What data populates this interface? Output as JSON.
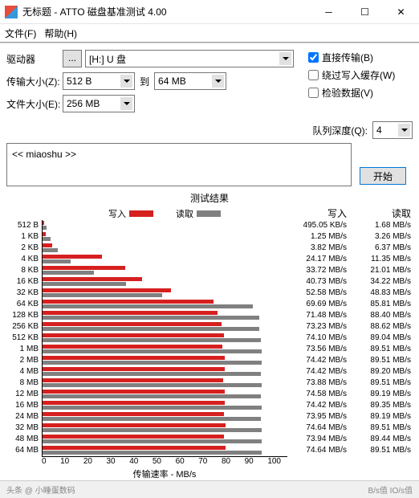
{
  "window": {
    "title": "无标题 - ATTO 磁盘基准测试 4.00"
  },
  "menu": {
    "file": "文件(F)",
    "help": "帮助(H)"
  },
  "labels": {
    "drive": "驱动器",
    "transfer_size": "传输大小(Z):",
    "to": "到",
    "file_size": "文件大小(E):",
    "queue_depth": "队列深度(Q):"
  },
  "controls": {
    "drive_dots": "...",
    "drive_value": "[H:] U 盘",
    "size_from": "512 B",
    "size_to": "64 MB",
    "file_size": "256 MB",
    "queue_depth": "4",
    "start": "开始"
  },
  "checkboxes": {
    "direct_io": "直接传输(B)",
    "bypass_cache": "绕过写入缓存(W)",
    "verify": "检验数据(V)"
  },
  "desc": {
    "text": "<< miaoshu >>"
  },
  "results": {
    "title": "测试结果",
    "write_legend": "写入",
    "read_legend": "读取",
    "write_hdr": "写入",
    "read_hdr": "读取",
    "x_label": "传输速率 - MB/s"
  },
  "chart_data": {
    "type": "bar",
    "x_ticks": [
      0,
      10,
      20,
      30,
      40,
      50,
      60,
      70,
      80,
      90,
      100
    ],
    "xlabel": "传输速率 - MB/s",
    "ylabel": "",
    "xlim": [
      0,
      100
    ],
    "series": [
      {
        "name": "写入",
        "color": "#d62020"
      },
      {
        "name": "读取",
        "color": "#808080"
      }
    ],
    "rows": [
      {
        "size": "512 B",
        "write": 0.495,
        "read": 1.68,
        "write_txt": "495.05 KB/s",
        "read_txt": "1.68 MB/s"
      },
      {
        "size": "1 KB",
        "write": 1.25,
        "read": 3.26,
        "write_txt": "1.25 MB/s",
        "read_txt": "3.26 MB/s"
      },
      {
        "size": "2 KB",
        "write": 3.82,
        "read": 6.37,
        "write_txt": "3.82 MB/s",
        "read_txt": "6.37 MB/s"
      },
      {
        "size": "4 KB",
        "write": 24.17,
        "read": 11.35,
        "write_txt": "24.17 MB/s",
        "read_txt": "11.35 MB/s"
      },
      {
        "size": "8 KB",
        "write": 33.72,
        "read": 21.01,
        "write_txt": "33.72 MB/s",
        "read_txt": "21.01 MB/s"
      },
      {
        "size": "16 KB",
        "write": 40.73,
        "read": 34.22,
        "write_txt": "40.73 MB/s",
        "read_txt": "34.22 MB/s"
      },
      {
        "size": "32 KB",
        "write": 52.58,
        "read": 48.83,
        "write_txt": "52.58 MB/s",
        "read_txt": "48.83 MB/s"
      },
      {
        "size": "64 KB",
        "write": 69.69,
        "read": 85.81,
        "write_txt": "69.69 MB/s",
        "read_txt": "85.81 MB/s"
      },
      {
        "size": "128 KB",
        "write": 71.48,
        "read": 88.4,
        "write_txt": "71.48 MB/s",
        "read_txt": "88.40 MB/s"
      },
      {
        "size": "256 KB",
        "write": 73.23,
        "read": 88.62,
        "write_txt": "73.23 MB/s",
        "read_txt": "88.62 MB/s"
      },
      {
        "size": "512 KB",
        "write": 74.1,
        "read": 89.04,
        "write_txt": "74.10 MB/s",
        "read_txt": "89.04 MB/s"
      },
      {
        "size": "1 MB",
        "write": 73.56,
        "read": 89.51,
        "write_txt": "73.56 MB/s",
        "read_txt": "89.51 MB/s"
      },
      {
        "size": "2 MB",
        "write": 74.42,
        "read": 89.51,
        "write_txt": "74.42 MB/s",
        "read_txt": "89.51 MB/s"
      },
      {
        "size": "4 MB",
        "write": 74.42,
        "read": 89.2,
        "write_txt": "74.42 MB/s",
        "read_txt": "89.20 MB/s"
      },
      {
        "size": "8 MB",
        "write": 73.88,
        "read": 89.51,
        "write_txt": "73.88 MB/s",
        "read_txt": "89.51 MB/s"
      },
      {
        "size": "12 MB",
        "write": 74.58,
        "read": 89.19,
        "write_txt": "74.58 MB/s",
        "read_txt": "89.19 MB/s"
      },
      {
        "size": "16 MB",
        "write": 74.42,
        "read": 89.35,
        "write_txt": "74.42 MB/s",
        "read_txt": "89.35 MB/s"
      },
      {
        "size": "24 MB",
        "write": 73.95,
        "read": 89.19,
        "write_txt": "73.95 MB/s",
        "read_txt": "89.19 MB/s"
      },
      {
        "size": "32 MB",
        "write": 74.64,
        "read": 89.51,
        "write_txt": "74.64 MB/s",
        "read_txt": "89.51 MB/s"
      },
      {
        "size": "48 MB",
        "write": 73.94,
        "read": 89.44,
        "write_txt": "73.94 MB/s",
        "read_txt": "89.44 MB/s"
      },
      {
        "size": "64 MB",
        "write": 74.64,
        "read": 89.51,
        "write_txt": "74.64 MB/s",
        "read_txt": "89.51 MB/s"
      }
    ]
  },
  "footer": {
    "left": "头条 @ 小睡蛋数码",
    "right": "B/s值   IO/s值"
  }
}
